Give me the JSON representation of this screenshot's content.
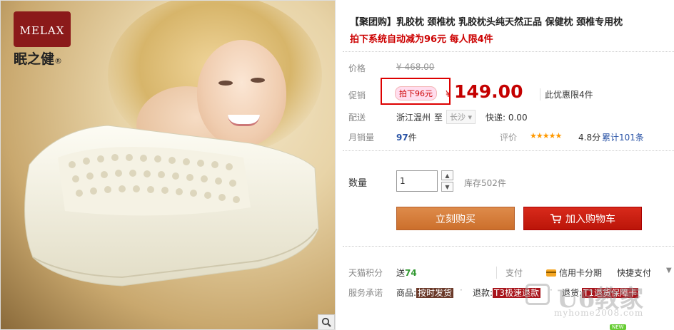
{
  "product_image": {
    "logo_brand": "MELAX",
    "logo_cn": "眠之健",
    "logo_reg": "®"
  },
  "title": "【聚团购】乳胶枕 颈椎枕 乳胶枕头纯天然正品 保健枕 颈椎专用枕",
  "subtitle": "拍下系统自动减为96元 每人限4件",
  "price": {
    "label": "价格",
    "original": "¥ 468.00",
    "promo_label": "促销",
    "promo_tag": "拍下96元",
    "currency": "¥",
    "current": "149.00",
    "limit_text": "此优惠限4件"
  },
  "shipping": {
    "label": "配送",
    "from": "浙江温州",
    "to_word": "至",
    "city": "长沙",
    "express": "快递: 0.00"
  },
  "sales": {
    "label": "月销量",
    "count": "97",
    "unit": "件",
    "rating_label": "评价",
    "stars": "★★★★★",
    "score": "4.8分",
    "reviews": "累计101条"
  },
  "quantity": {
    "label": "数量",
    "value": "1",
    "stock": "库存502件"
  },
  "buttons": {
    "buy_now": "立刻购买",
    "add_cart": "加入购物车"
  },
  "points": {
    "label": "天猫积分",
    "prefix": "送",
    "value": "74",
    "pay_label": "支付",
    "credit": "信用卡分期",
    "fast_pay": "快捷支付"
  },
  "service": {
    "label": "服务承诺",
    "goods_prefix": "商品:",
    "goods_tag": "按时发货",
    "refund_prefix": "退款:",
    "refund_tag": "T3极速退款",
    "return_prefix": "退货:",
    "return_tag": "T1退货保障卡"
  },
  "watermark": {
    "text": "U6教家",
    "url": "myhome2008.com",
    "new": "NEW"
  },
  "colors": {
    "price_red": "#c40000",
    "buy_orange": "#d57d3b",
    "cart_red": "#c8180b"
  }
}
